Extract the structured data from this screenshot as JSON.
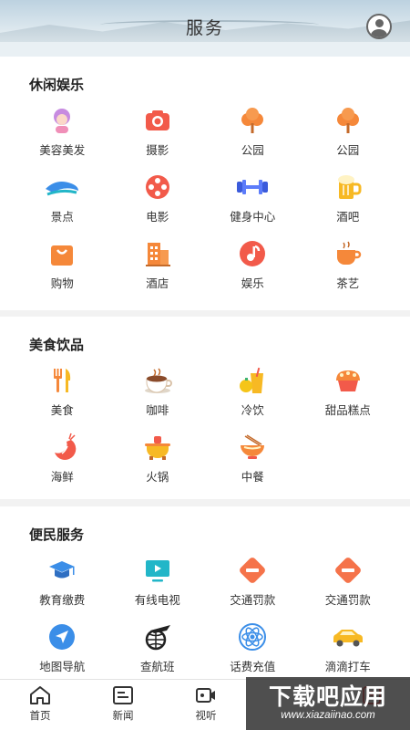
{
  "header": {
    "title": "服务"
  },
  "sections": [
    {
      "title": "休闲娱乐",
      "items": [
        {
          "label": "美容美发",
          "icon": "beauty-salon-icon"
        },
        {
          "label": "摄影",
          "icon": "camera-icon"
        },
        {
          "label": "公园",
          "icon": "park-tree-icon"
        },
        {
          "label": "公园",
          "icon": "park-tree-icon"
        },
        {
          "label": "景点",
          "icon": "scenic-wave-icon"
        },
        {
          "label": "电影",
          "icon": "film-reel-icon"
        },
        {
          "label": "健身中心",
          "icon": "dumbbell-icon"
        },
        {
          "label": "酒吧",
          "icon": "beer-mug-icon"
        },
        {
          "label": "购物",
          "icon": "shopping-bag-icon"
        },
        {
          "label": "酒店",
          "icon": "hotel-building-icon"
        },
        {
          "label": "娱乐",
          "icon": "music-note-icon"
        },
        {
          "label": "茶艺",
          "icon": "tea-cup-icon"
        }
      ]
    },
    {
      "title": "美食饮品",
      "items": [
        {
          "label": "美食",
          "icon": "fork-knife-icon"
        },
        {
          "label": "咖啡",
          "icon": "coffee-cup-icon"
        },
        {
          "label": "冷饮",
          "icon": "cold-drink-icon"
        },
        {
          "label": "甜品糕点",
          "icon": "cupcake-icon"
        },
        {
          "label": "海鲜",
          "icon": "shrimp-icon"
        },
        {
          "label": "火锅",
          "icon": "hotpot-icon"
        },
        {
          "label": "中餐",
          "icon": "noodle-bowl-icon"
        }
      ]
    },
    {
      "title": "便民服务",
      "items": [
        {
          "label": "教育缴费",
          "icon": "graduation-cap-icon"
        },
        {
          "label": "有线电视",
          "icon": "tv-icon"
        },
        {
          "label": "交通罚款",
          "icon": "no-entry-icon"
        },
        {
          "label": "交通罚款",
          "icon": "no-entry-icon"
        },
        {
          "label": "地图导航",
          "icon": "navigation-arrow-icon"
        },
        {
          "label": "查航班",
          "icon": "plane-globe-icon"
        },
        {
          "label": "话费充值",
          "icon": "atom-phone-icon"
        },
        {
          "label": "滴滴打车",
          "icon": "car-icon"
        }
      ]
    }
  ],
  "tabbar": {
    "items": [
      {
        "label": "首页",
        "icon": "home-icon"
      },
      {
        "label": "新闻",
        "icon": "news-icon"
      },
      {
        "label": "视听",
        "icon": "video-icon"
      },
      {
        "label": "",
        "icon": "service-icon"
      },
      {
        "label": "",
        "icon": "profile-icon"
      }
    ]
  },
  "watermark": {
    "line1": "下载吧应用",
    "line2": "www.xiazaiinao.com"
  },
  "colors": {
    "accent_orange": "#f5883a",
    "accent_red": "#f25a4a",
    "accent_blue": "#3b8ee8",
    "accent_teal": "#22b6c8"
  }
}
